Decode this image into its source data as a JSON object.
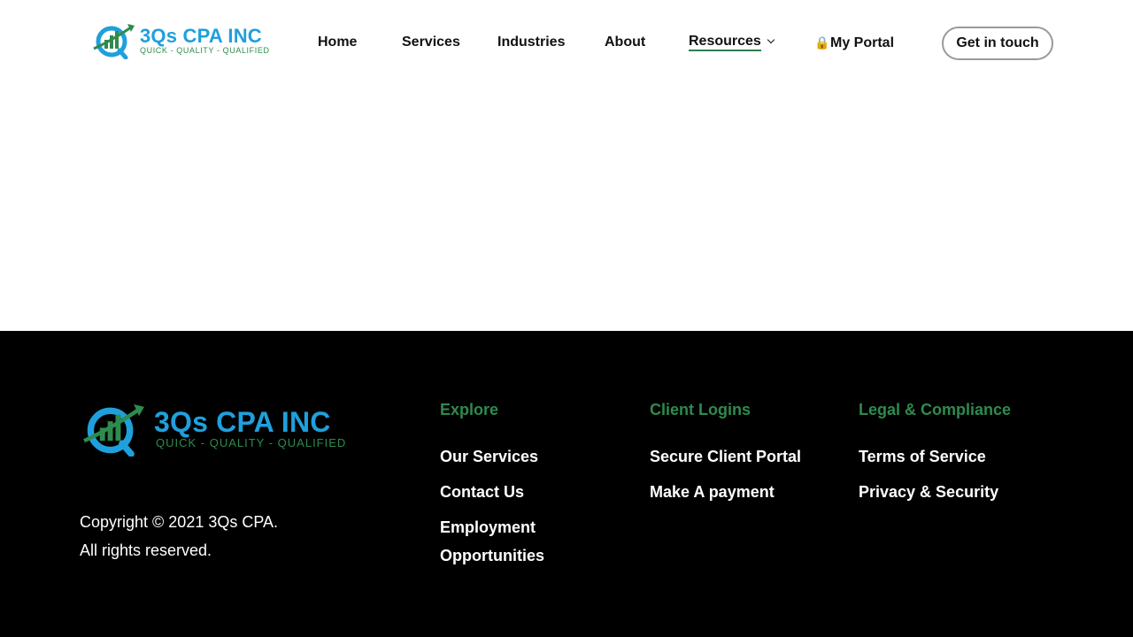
{
  "brand": {
    "name": "3Qs CPA INC",
    "tagline": "QUICK - QUALITY - QUALIFIED",
    "colors": {
      "blue": "#1fa0dc",
      "green": "#2e8b4e"
    }
  },
  "nav": {
    "items": [
      {
        "label": "Home"
      },
      {
        "label": "Services"
      },
      {
        "label": "Industries"
      },
      {
        "label": "About"
      },
      {
        "label": "Resources",
        "icon": "chevron-down-icon",
        "active": true
      },
      {
        "label": "My Portal",
        "icon": "lock-icon"
      }
    ],
    "cta_label": "Get in touch"
  },
  "footer": {
    "copyright_line1": "Copyright © 2021 3Qs CPA.",
    "copyright_line2": "All rights reserved.",
    "columns": [
      {
        "heading": "Explore",
        "links": [
          "Our Services",
          "Contact Us",
          "Employment Opportunities"
        ]
      },
      {
        "heading": "Client Logins",
        "links": [
          "Secure Client Portal",
          "Make A payment"
        ]
      },
      {
        "heading": "Legal & Compliance",
        "links": [
          "Terms of Service",
          "Privacy & Security"
        ]
      }
    ],
    "heading_color": "#2f8a4f"
  }
}
